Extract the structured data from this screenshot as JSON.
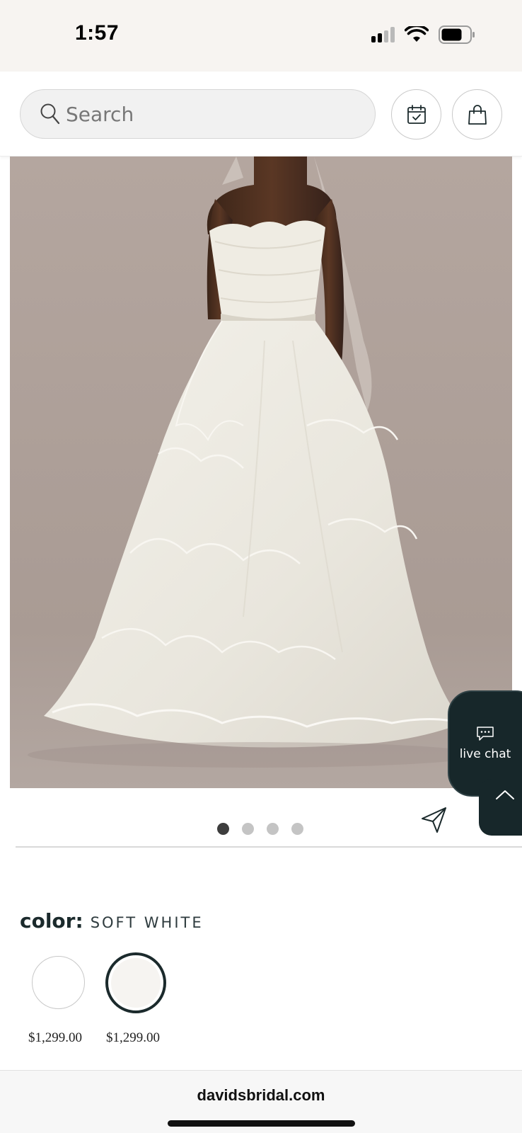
{
  "status_bar": {
    "time": "1:57"
  },
  "header": {
    "search_placeholder": "Search",
    "icons": [
      "search-icon",
      "calendar-icon",
      "shopping-bag-icon"
    ]
  },
  "product_image": {
    "carousel_count": 4,
    "carousel_active_index": 0
  },
  "live_chat": {
    "label": "live chat"
  },
  "color": {
    "label": "color:",
    "value": "SOFT WHITE",
    "swatches": [
      {
        "price": "$1,299.00",
        "selected": false,
        "color": "#ffffff"
      },
      {
        "price": "$1,299.00",
        "selected": true,
        "color": "#f6f4f1"
      }
    ]
  },
  "browser": {
    "url": "davidsbridal.com"
  },
  "colors": {
    "accent_dark": "#17272a",
    "status_bar_bg": "#f7f4f1",
    "image_bg": "#ab9d96"
  }
}
